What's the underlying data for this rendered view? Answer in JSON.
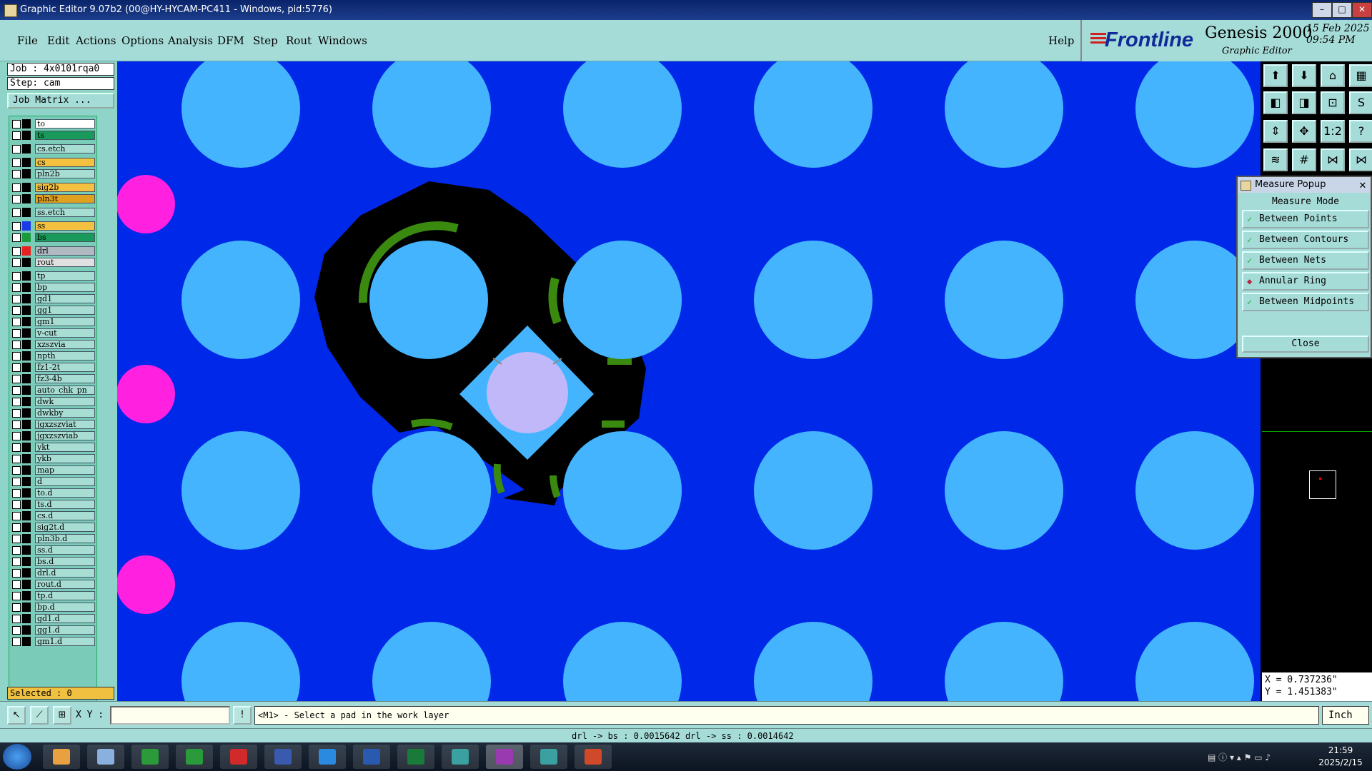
{
  "window": {
    "title": "Graphic Editor 9.07b2 (00@HY-HYCAM-PC411 - Windows, pid:5776)"
  },
  "menu": {
    "items": [
      "File",
      "Edit",
      "Actions",
      "Options",
      "Analysis",
      "DFM",
      "Step",
      "Rout",
      "Windows"
    ],
    "help": "Help"
  },
  "logo": {
    "brand": "Frontline",
    "product": "Genesis 2000",
    "subtitle": "Graphic Editor",
    "date": "15 Feb 2025",
    "time": "09:54 PM"
  },
  "job": {
    "job_label": "Job : 4x0101rqa0",
    "step_label": "Step: cam",
    "matrix_button": "Job Matrix ..."
  },
  "layers": [
    {
      "name": "to",
      "color": "#000000",
      "name_bg": "#ffffff"
    },
    {
      "name": "ts",
      "color": "#000000",
      "name_bg": "#1a9a5a"
    },
    {
      "name": "cs.etch",
      "color": "#000000",
      "name_bg": "#a8ddd3"
    },
    {
      "name": "cs",
      "color": "#000000",
      "name_bg": "#f4c040"
    },
    {
      "name": "pln2b",
      "color": "#000000",
      "name_bg": "#a8ddd3"
    },
    {
      "name": "sig2b",
      "color": "#000000",
      "name_bg": "#f4c040"
    },
    {
      "name": "pln3t",
      "color": "#000000",
      "name_bg": "#e0a020"
    },
    {
      "name": "ss.etch",
      "color": "#000000",
      "name_bg": "#a8ddd3"
    },
    {
      "name": "ss",
      "color": "#1a3ae8",
      "name_bg": "#f4c040"
    },
    {
      "name": "bs",
      "color": "#1a9a3a",
      "name_bg": "#1a9a5a"
    },
    {
      "name": "drl",
      "color": "#e82020",
      "name_bg": "#b0b8c0"
    },
    {
      "name": "rout",
      "color": "#000000",
      "name_bg": "#e0e0e0"
    },
    {
      "name": "tp",
      "color": "#000000",
      "name_bg": "#a8ddd3"
    },
    {
      "name": "bp",
      "color": "#000000",
      "name_bg": "#a8ddd3"
    },
    {
      "name": "gd1",
      "color": "#000000",
      "name_bg": "#a8ddd3"
    },
    {
      "name": "gg1",
      "color": "#000000",
      "name_bg": "#a8ddd3"
    },
    {
      "name": "gm1",
      "color": "#000000",
      "name_bg": "#a8ddd3"
    },
    {
      "name": "v-cut",
      "color": "#000000",
      "name_bg": "#a8ddd3"
    },
    {
      "name": "xzszvia",
      "color": "#000000",
      "name_bg": "#a8ddd3"
    },
    {
      "name": "npth",
      "color": "#000000",
      "name_bg": "#a8ddd3"
    },
    {
      "name": "fz1-2t",
      "color": "#000000",
      "name_bg": "#a8ddd3"
    },
    {
      "name": "fz3-4b",
      "color": "#000000",
      "name_bg": "#a8ddd3"
    },
    {
      "name": "auto_chk_pn",
      "color": "#000000",
      "name_bg": "#a8ddd3"
    },
    {
      "name": "dwk",
      "color": "#000000",
      "name_bg": "#a8ddd3"
    },
    {
      "name": "dwkby",
      "color": "#000000",
      "name_bg": "#a8ddd3"
    },
    {
      "name": "jgxzszviat",
      "color": "#000000",
      "name_bg": "#a8ddd3"
    },
    {
      "name": "jgxzszviab",
      "color": "#000000",
      "name_bg": "#a8ddd3"
    },
    {
      "name": "ykt",
      "color": "#000000",
      "name_bg": "#a8ddd3"
    },
    {
      "name": "ykb",
      "color": "#000000",
      "name_bg": "#a8ddd3"
    },
    {
      "name": "map",
      "color": "#000000",
      "name_bg": "#a8ddd3"
    },
    {
      "name": "d",
      "color": "#000000",
      "name_bg": "#a8ddd3"
    },
    {
      "name": "to.d",
      "color": "#000000",
      "name_bg": "#a8ddd3"
    },
    {
      "name": "ts.d",
      "color": "#000000",
      "name_bg": "#a8ddd3"
    },
    {
      "name": "cs.d",
      "color": "#000000",
      "name_bg": "#a8ddd3"
    },
    {
      "name": "sig2t.d",
      "color": "#000000",
      "name_bg": "#a8ddd3"
    },
    {
      "name": "pln3b.d",
      "color": "#000000",
      "name_bg": "#a8ddd3"
    },
    {
      "name": "ss.d",
      "color": "#000000",
      "name_bg": "#a8ddd3"
    },
    {
      "name": "bs.d",
      "color": "#000000",
      "name_bg": "#a8ddd3"
    },
    {
      "name": "drl.d",
      "color": "#000000",
      "name_bg": "#a8ddd3"
    },
    {
      "name": "rout.d",
      "color": "#000000",
      "name_bg": "#a8ddd3"
    },
    {
      "name": "tp.d",
      "color": "#000000",
      "name_bg": "#a8ddd3"
    },
    {
      "name": "bp.d",
      "color": "#000000",
      "name_bg": "#a8ddd3"
    },
    {
      "name": "gd1.d",
      "color": "#000000",
      "name_bg": "#a8ddd3"
    },
    {
      "name": "gg1.d",
      "color": "#000000",
      "name_bg": "#a8ddd3"
    },
    {
      "name": "gm1.d",
      "color": "#000000",
      "name_bg": "#a8ddd3"
    }
  ],
  "selected": "Selected : 0",
  "measure_popup": {
    "title": "Measure Popup",
    "mode_label": "Measure Mode",
    "options": [
      "Between Points",
      "Between Contours",
      "Between Nets",
      "Annular Ring",
      "Between Midpoints"
    ],
    "selected_option": "Annular Ring",
    "close_label": "Close"
  },
  "coords": {
    "x": "X = 0.737236\"",
    "y": "Y = 1.451383\""
  },
  "bottom": {
    "xy_label": "X Y :",
    "prompt": "<M1> - Select a pad in the work layer",
    "units": "Inch"
  },
  "status": "drl -> bs : 0.0015642   drl -> ss : 0.0014642",
  "taskbar": {
    "time": "21:59",
    "date": "2025/2/15"
  },
  "colors": {
    "canvas_bg": "#0028e8",
    "pad": "#44b4ff",
    "magenta_pad": "#ff20e0",
    "drill": "#c0b8f8",
    "copper_black": "#000000",
    "mask_green": "#3a8a10"
  }
}
